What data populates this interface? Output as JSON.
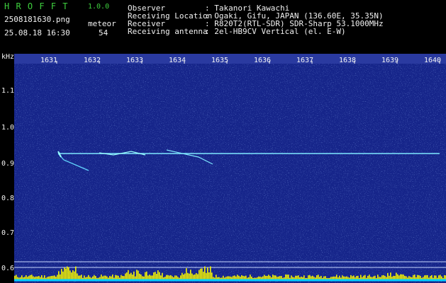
{
  "header": {
    "app_name": "H R O F F T",
    "version": "1.0.0",
    "filename": "2508181630.png",
    "datetime": "25.08.18 16:30",
    "count_label": "meteor",
    "count_value": "54",
    "info_labels": [
      "Observer",
      "Receiving Location",
      "Receiver",
      "Receiving antenna"
    ],
    "info_values": [
      ": Takanori Kawachi",
      ": Ogaki, Gifu, JAPAN (136.60E, 35.35N)",
      ": R820T2(RTL-SDR) SDR-Sharp 53.1000MHz",
      ": 2el-HB9CV Vertical (el. E-W)"
    ]
  },
  "spectrogram": {
    "y_axis_unit": "kHz",
    "y_ticks": [
      "1.1",
      "1.0",
      "0.9",
      "0.8",
      "0.7",
      "0.6"
    ],
    "x_ticks": [
      "1631",
      "1632",
      "1633",
      "1634",
      "1635",
      "1636",
      "1637",
      "1638",
      "1639",
      "1640"
    ],
    "background_color": "#1a2a8a",
    "carrier_color": "#7fe8ff",
    "bar_color": "#f4f400",
    "baseline_color": "#00d0ff"
  }
}
